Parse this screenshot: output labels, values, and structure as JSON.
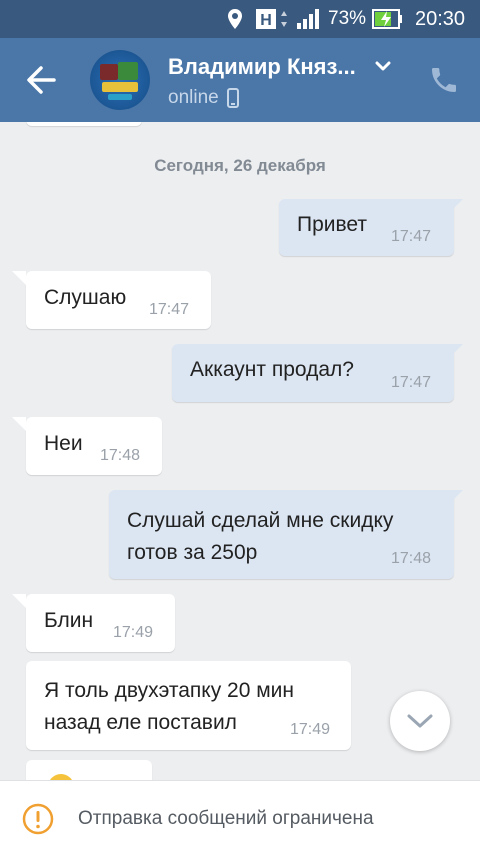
{
  "status_bar": {
    "battery_percent": "73%",
    "time": "20:30",
    "icons": [
      "location-icon",
      "h-network-icon",
      "signal-icon",
      "battery-charging-icon"
    ]
  },
  "header": {
    "contact_name": "Владимир Княз...",
    "status": "online",
    "icons": [
      "back-arrow-icon",
      "chevron-down-icon",
      "mobile-icon",
      "phone-icon"
    ]
  },
  "chat": {
    "date_separator": "Сегодня, 26 декабря",
    "messages": [
      {
        "dir": "out",
        "text": "Привет",
        "time": "17:47"
      },
      {
        "dir": "in",
        "text": "Слушаю",
        "time": "17:47"
      },
      {
        "dir": "out",
        "text": "Аккаунт продал?",
        "time": "17:47"
      },
      {
        "dir": "in",
        "text": "Неи",
        "time": "17:48"
      },
      {
        "dir": "out",
        "text": "Слушай сделай мне скидку\nготов за 250р",
        "time": "17:48"
      },
      {
        "dir": "in",
        "text": "Блин",
        "time": "17:49"
      },
      {
        "dir": "in",
        "text": "Я толь двухэтапку 20 мин\nназад еле поставил",
        "time": "17:49"
      }
    ]
  },
  "footer": {
    "notice": "Отправка сообщений ограничена"
  },
  "colors": {
    "header": "#4a76a8",
    "status_bar": "#39597e",
    "outgoing_bubble": "#dce6f3",
    "incoming_bubble": "#ffffff",
    "warning": "#f0a030"
  }
}
